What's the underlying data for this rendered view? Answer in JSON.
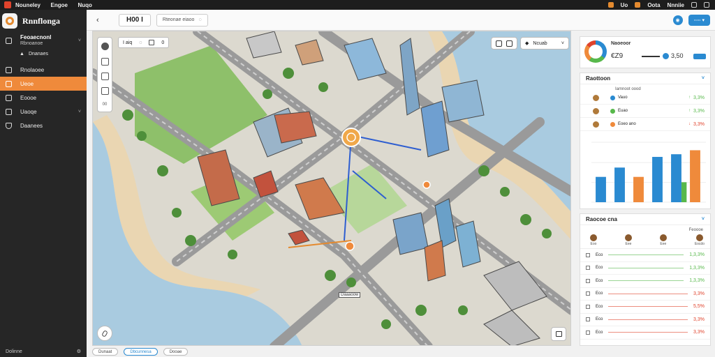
{
  "app": {
    "menu": [
      "Nouneley",
      "Engoe",
      "Nuqo"
    ],
    "top_right": [
      "Uo",
      "Oota",
      "Nnniie"
    ]
  },
  "sidebar": {
    "brand": "Rnnflonga",
    "sub_title": "Feoaecnonl",
    "sub_value": "Rbnoanoe",
    "sub_item": "Dnanaes",
    "items": [
      {
        "label": "Rnolaoee",
        "icon": "map-icon"
      },
      {
        "label": "Ueoe",
        "icon": "layers-icon",
        "active": true
      },
      {
        "label": "Eoooe",
        "icon": "grid-icon"
      },
      {
        "label": "Uaoqe",
        "icon": "calendar-icon"
      },
      {
        "label": "Daanees",
        "icon": "shield-icon"
      }
    ],
    "footer": "Dolinne"
  },
  "toolbar": {
    "title": "H00 I",
    "search_text": "Rteonae eiaoo"
  },
  "map": {
    "search_text": "I aiq",
    "control_text": "Ncuab",
    "zoom_label": "00",
    "place_label": "Daaaoow"
  },
  "bottom_tabs": [
    "Dunaat",
    "Dbcunnesa",
    "Dooae"
  ],
  "summary": {
    "label": "Naoeoor",
    "value1": "€Z9",
    "value2": "3,50"
  },
  "breakdown": {
    "title": "Raottoon",
    "subhead": "Iamnoot oood",
    "rows": [
      {
        "label": "Vauo",
        "pct": "3,3%",
        "color": "#2a8ad1"
      },
      {
        "label": "Euao",
        "pct": "3,3%",
        "color": "#57b84b"
      },
      {
        "label": "Eoeo ano",
        "pct": "3,3%",
        "color": "#ef8a3b"
      }
    ]
  },
  "chart_data": {
    "type": "bar",
    "categories": [
      "",
      "",
      "",
      "",
      "",
      ""
    ],
    "values": [
      38,
      52,
      38,
      68,
      72,
      78
    ],
    "colors": [
      "#2a8ad1",
      "#2a8ad1",
      "#ef8a3b",
      "#2a8ad1",
      "#2a8ad1",
      "#ef8a3b"
    ],
    "overlay": {
      "index": 4,
      "value": 30,
      "color": "#57b84b"
    },
    "ylim": [
      0,
      90
    ],
    "title": "",
    "xlabel": "",
    "ylabel": ""
  },
  "ranking": {
    "title": "Raocoe cna",
    "subhead": "Feoooe",
    "avatars": [
      "Eoo",
      "Eee",
      "Eee",
      "Eocdo"
    ],
    "rows": [
      {
        "label": "Eco",
        "value": "1,3,3%",
        "color": "#57b84b"
      },
      {
        "label": "Eco",
        "value": "1,3,3%",
        "color": "#57b84b"
      },
      {
        "label": "Eco",
        "value": "1,3,3%",
        "color": "#57b84b"
      },
      {
        "label": "Eco",
        "value": "3,3%",
        "color": "#e0432c"
      },
      {
        "label": "Eco",
        "value": "5,5%",
        "color": "#e0432c"
      },
      {
        "label": "Eco",
        "value": "3,3%",
        "color": "#e0432c"
      },
      {
        "label": "Eco",
        "value": "3,3%",
        "color": "#e0432c"
      }
    ]
  }
}
